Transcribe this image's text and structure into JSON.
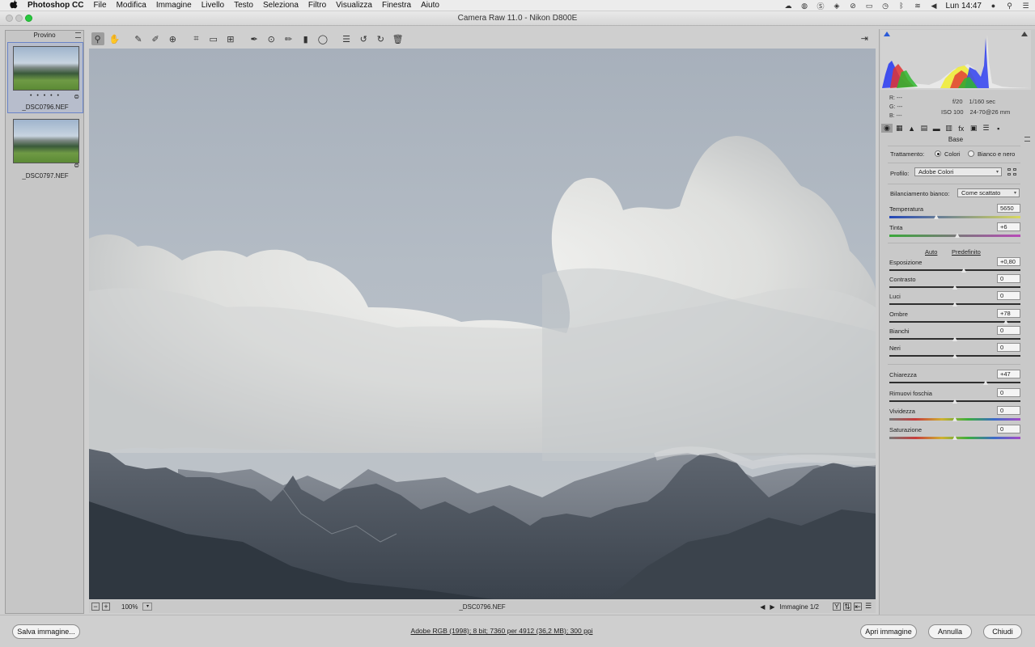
{
  "menubar": {
    "app": "Photoshop CC",
    "items": [
      "File",
      "Modifica",
      "Immagine",
      "Livello",
      "Testo",
      "Seleziona",
      "Filtro",
      "Visualizza",
      "Finestra",
      "Aiuto"
    ],
    "clock": "Lun 14:47",
    "status_icons": [
      "creative-cloud-icon",
      "sync-icon",
      "skype-icon",
      "dropbox-icon",
      "vpn-icon",
      "battery-icon",
      "time-machine-icon",
      "bluetooth-icon",
      "wifi-icon",
      "volume-icon",
      "user-icon",
      "spotlight-icon",
      "notifications-icon"
    ]
  },
  "window": {
    "title": "Camera Raw 11.0  -  Nikon D800E"
  },
  "filmstrip": {
    "title": "Provino",
    "items": [
      {
        "name": "_DSC0796.NEF",
        "stars": "• • • • •",
        "selected": true
      },
      {
        "name": "_DSC0797.NEF",
        "stars": "",
        "selected": false
      }
    ]
  },
  "toolbar": {
    "tools": [
      "zoom-icon",
      "hand-icon",
      "white-balance-icon",
      "color-sampler-icon",
      "targeted-adjustment-icon",
      "crop-icon",
      "straighten-icon",
      "transform-icon",
      "spot-removal-icon",
      "red-eye-icon",
      "adjustment-brush-icon",
      "graduated-filter-icon",
      "radial-filter-icon",
      "preferences-icon",
      "rotate-left-icon",
      "rotate-right-icon",
      "trash-icon"
    ]
  },
  "preview_status": {
    "zoom": "100%",
    "filename": "_DSC0796.NEF",
    "image_counter": "Immagine 1/2"
  },
  "histogram": {
    "rgb": {
      "r": "R:  ---",
      "g": "G:  ---",
      "b": "B:  ---"
    },
    "aperture": "f/20",
    "shutter": "1/160 sec",
    "iso": "ISO 100",
    "lens": "24-70@26 mm"
  },
  "panel": {
    "title": "Base",
    "treatment_label": "Trattamento:",
    "treatment_color": "Colori",
    "treatment_bw": "Bianco e nero",
    "profile_label": "Profilo:",
    "profile_value": "Adobe Colori",
    "wb_label": "Bilanciamento bianco:",
    "wb_value": "Come scattato",
    "auto": "Auto",
    "default": "Predefinito",
    "sliders": {
      "temperatura": {
        "label": "Temperatura",
        "value": "5650",
        "pos": 0.36
      },
      "tinta": {
        "label": "Tinta",
        "value": "+6",
        "pos": 0.52
      },
      "esposizione": {
        "label": "Esposizione",
        "value": "+0,80",
        "pos": 0.57
      },
      "contrasto": {
        "label": "Contrasto",
        "value": "0",
        "pos": 0.5
      },
      "luci": {
        "label": "Luci",
        "value": "0",
        "pos": 0.5
      },
      "ombre": {
        "label": "Ombre",
        "value": "+78",
        "pos": 0.89
      },
      "bianchi": {
        "label": "Bianchi",
        "value": "0",
        "pos": 0.5
      },
      "neri": {
        "label": "Neri",
        "value": "0",
        "pos": 0.5
      },
      "chiarezza": {
        "label": "Chiarezza",
        "value": "+47",
        "pos": 0.735
      },
      "rimuovi_foschia": {
        "label": "Rimuovi foschia",
        "value": "0",
        "pos": 0.5
      },
      "vividezza": {
        "label": "Vividezza",
        "value": "0",
        "pos": 0.5
      },
      "saturazione": {
        "label": "Saturazione",
        "value": "0",
        "pos": 0.5
      }
    }
  },
  "bottom": {
    "save": "Salva immagine...",
    "workflow": "Adobe RGB (1998); 8 bit; 7360 per 4912 (36,2 MB); 300 ppi",
    "open": "Apri immagine",
    "cancel": "Annulla",
    "close": "Chiudi"
  },
  "colors": {
    "accent": "#6a84c8",
    "window_bg": "#c9c9c9",
    "panel_bg": "#c9c9c9"
  }
}
